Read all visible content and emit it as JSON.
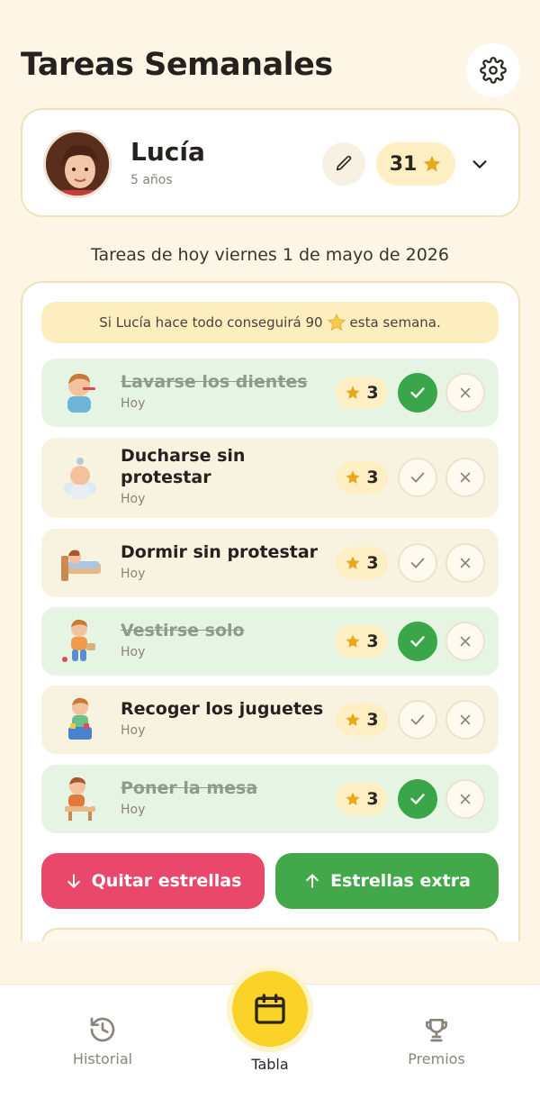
{
  "header": {
    "title": "Tareas Semanales"
  },
  "profile": {
    "name": "Lucía",
    "age": "5 años",
    "stars": "31"
  },
  "date_line": "Tareas de hoy viernes 1 de mayo de 2026",
  "banner": {
    "before": "Si Lucía hace todo conseguirá 90",
    "after": "esta semana."
  },
  "tasks": [
    {
      "title": "Lavarse los dientes",
      "sub": "Hoy",
      "stars": "3",
      "done": true
    },
    {
      "title": "Ducharse sin protestar",
      "sub": "Hoy",
      "stars": "3",
      "done": false
    },
    {
      "title": "Dormir sin protestar",
      "sub": "Hoy",
      "stars": "3",
      "done": false
    },
    {
      "title": "Vestirse solo",
      "sub": "Hoy",
      "stars": "3",
      "done": true
    },
    {
      "title": "Recoger los juguetes",
      "sub": "Hoy",
      "stars": "3",
      "done": false
    },
    {
      "title": "Poner la mesa",
      "sub": "Hoy",
      "stars": "3",
      "done": true
    }
  ],
  "actions": {
    "remove": "Quitar estrellas",
    "extra": "Estrellas extra"
  },
  "nav": {
    "history": "Historial",
    "board": "Tabla",
    "prizes": "Premios"
  },
  "colors": {
    "accent": "#fbd228",
    "success": "#43a84a",
    "danger": "#e9486a",
    "background": "#fdf6e6"
  },
  "icons": [
    "gear-icon",
    "pencil-icon",
    "star-icon",
    "chevron-down-icon",
    "check-icon",
    "close-icon",
    "arrow-down-icon",
    "arrow-up-icon",
    "history-icon",
    "calendar-icon",
    "trophy-icon"
  ]
}
